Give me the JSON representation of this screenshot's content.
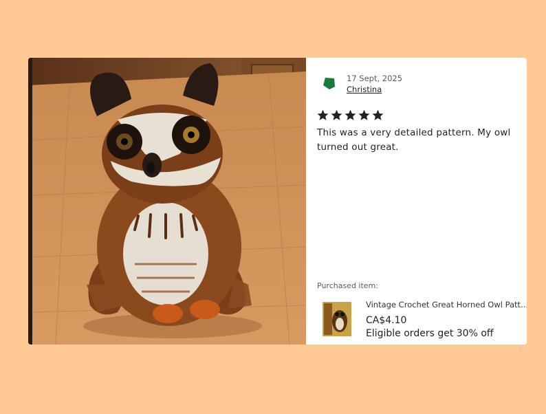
{
  "review": {
    "date": "17 Sept, 2025",
    "author": "Christina",
    "rating": 5,
    "text": "This was a very detailed pattern. My owl turned out great.",
    "avatar_color": "#1a7a3c"
  },
  "purchase": {
    "label": "Purchased item:",
    "title": "Vintage Crochet Great Horned Owl Patt...",
    "price": "CA$4.10",
    "promo": "Eligible orders get 30% off"
  },
  "colors": {
    "background": "#fec995",
    "star": "#222222"
  }
}
